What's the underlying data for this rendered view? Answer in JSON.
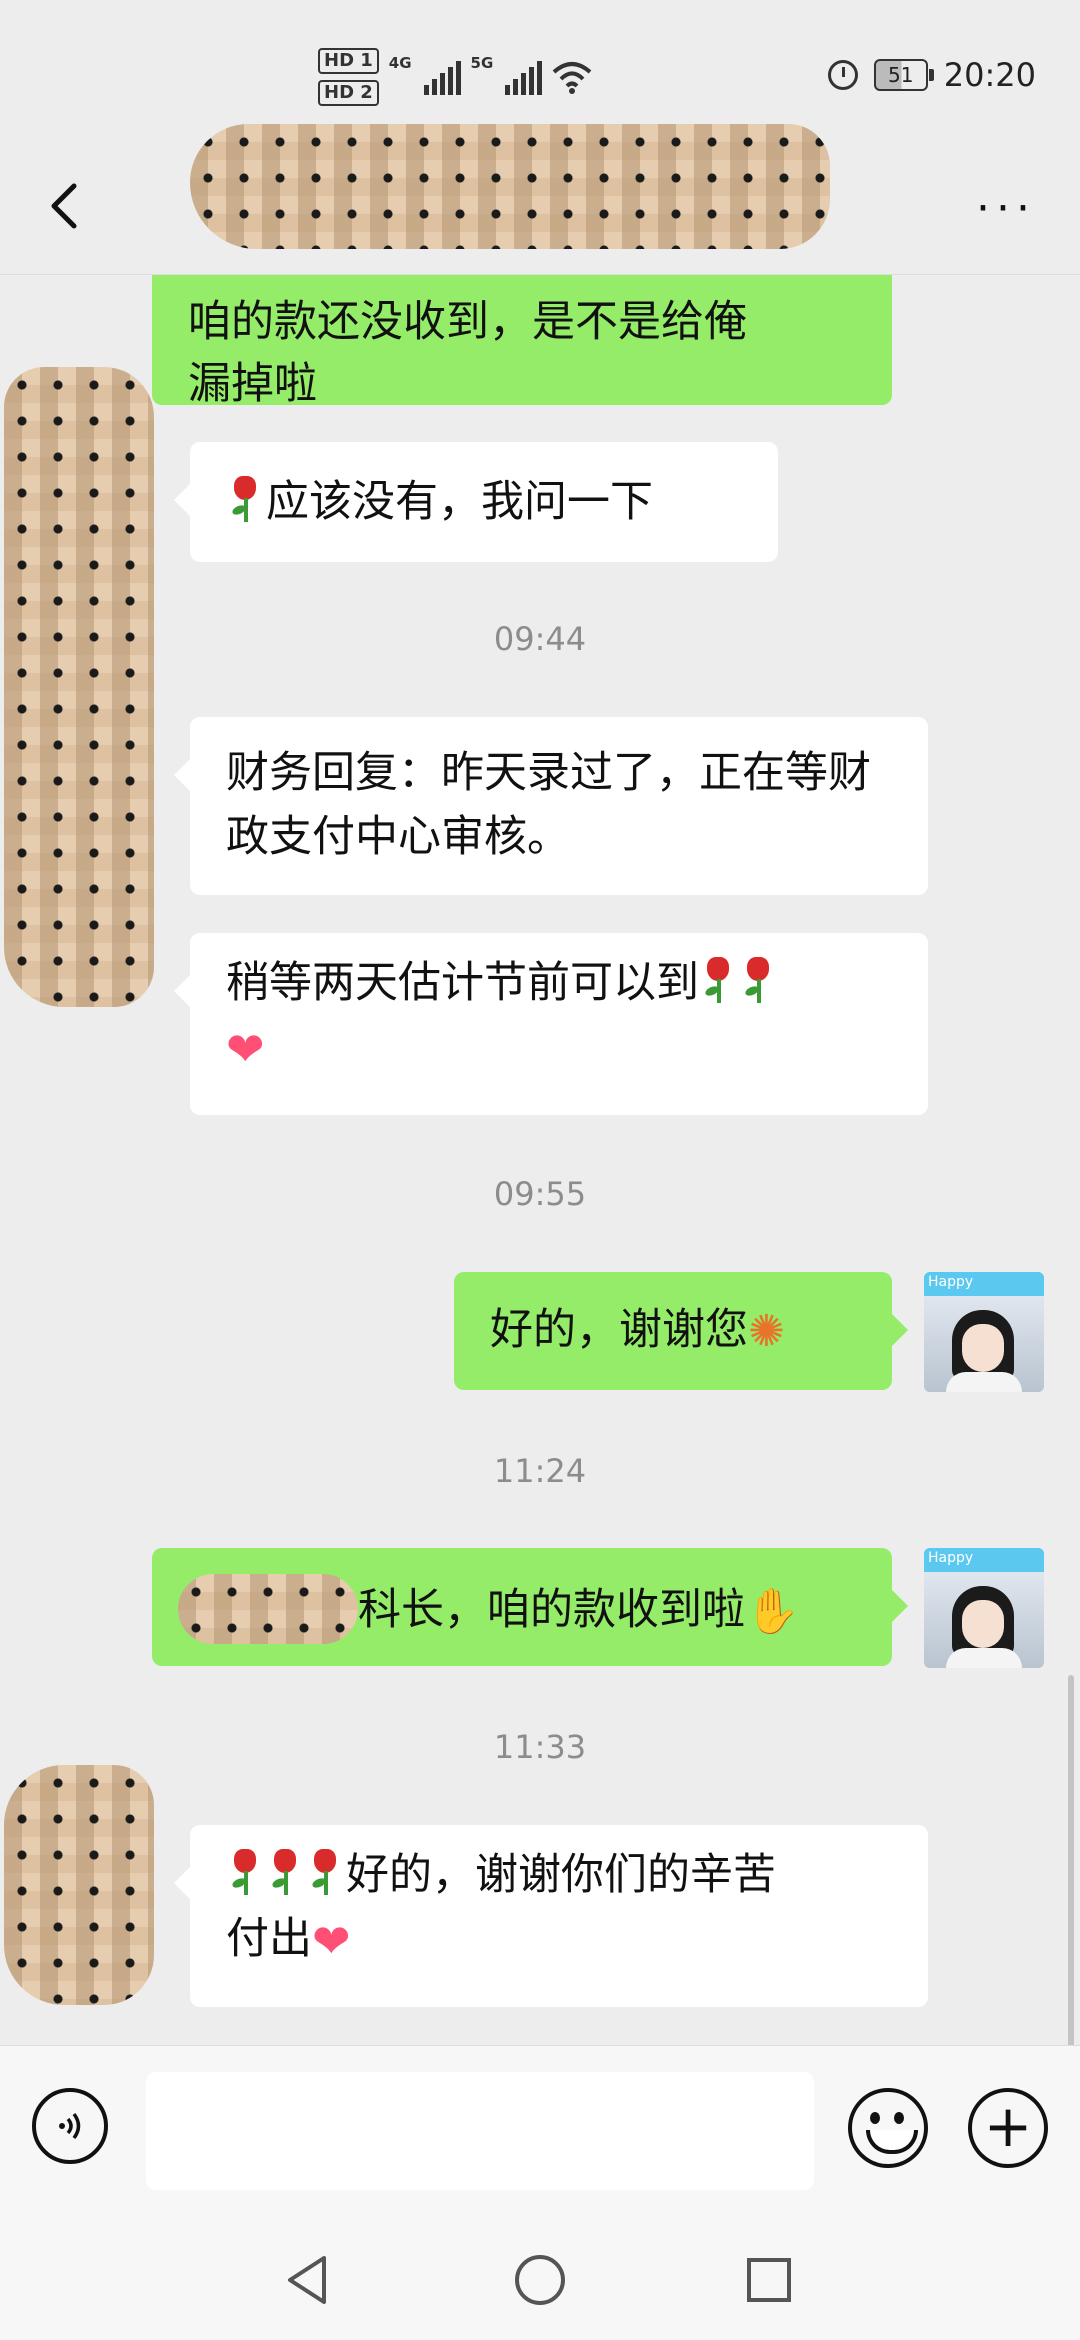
{
  "status_bar": {
    "sim1": "HD 1",
    "sim2": "HD 2",
    "net1": "4G",
    "net2": "5G",
    "battery": "51",
    "time": "20:20"
  },
  "header": {
    "back_icon": "chevron-left-icon",
    "more_icon": "more-dots-icon",
    "more_label": "···"
  },
  "messages": [
    {
      "type": "out",
      "text_line1": "咱的款还没收到，是不是给俺",
      "text_line2": "漏掉啦"
    },
    {
      "type": "in",
      "text": "应该没有，我问一下"
    },
    {
      "type": "time",
      "text": "09:44"
    },
    {
      "type": "in",
      "text": "财务回复：昨天录过了，正在等财政支付中心审核。"
    },
    {
      "type": "in",
      "text": "稍等两天估计节前可以到"
    },
    {
      "type": "time",
      "text": "09:55"
    },
    {
      "type": "out",
      "text": "好的，谢谢您"
    },
    {
      "type": "time",
      "text": "11:24"
    },
    {
      "type": "out",
      "text": "科长，咱的款收到啦"
    },
    {
      "type": "time",
      "text": "11:33"
    },
    {
      "type": "in",
      "text_line1": "好的，谢谢你们的辛苦",
      "text_line2": "付出"
    }
  ],
  "my_avatar": {
    "banner_text": "Happy"
  },
  "input_bar": {
    "voice_icon": "voice-icon",
    "emoji_icon": "smiley-icon",
    "plus_icon": "plus-icon"
  },
  "colors": {
    "background": "#ededed",
    "outgoing_bubble": "#95ec69",
    "incoming_bubble": "#ffffff",
    "timestamp": "#8c8c8c"
  }
}
